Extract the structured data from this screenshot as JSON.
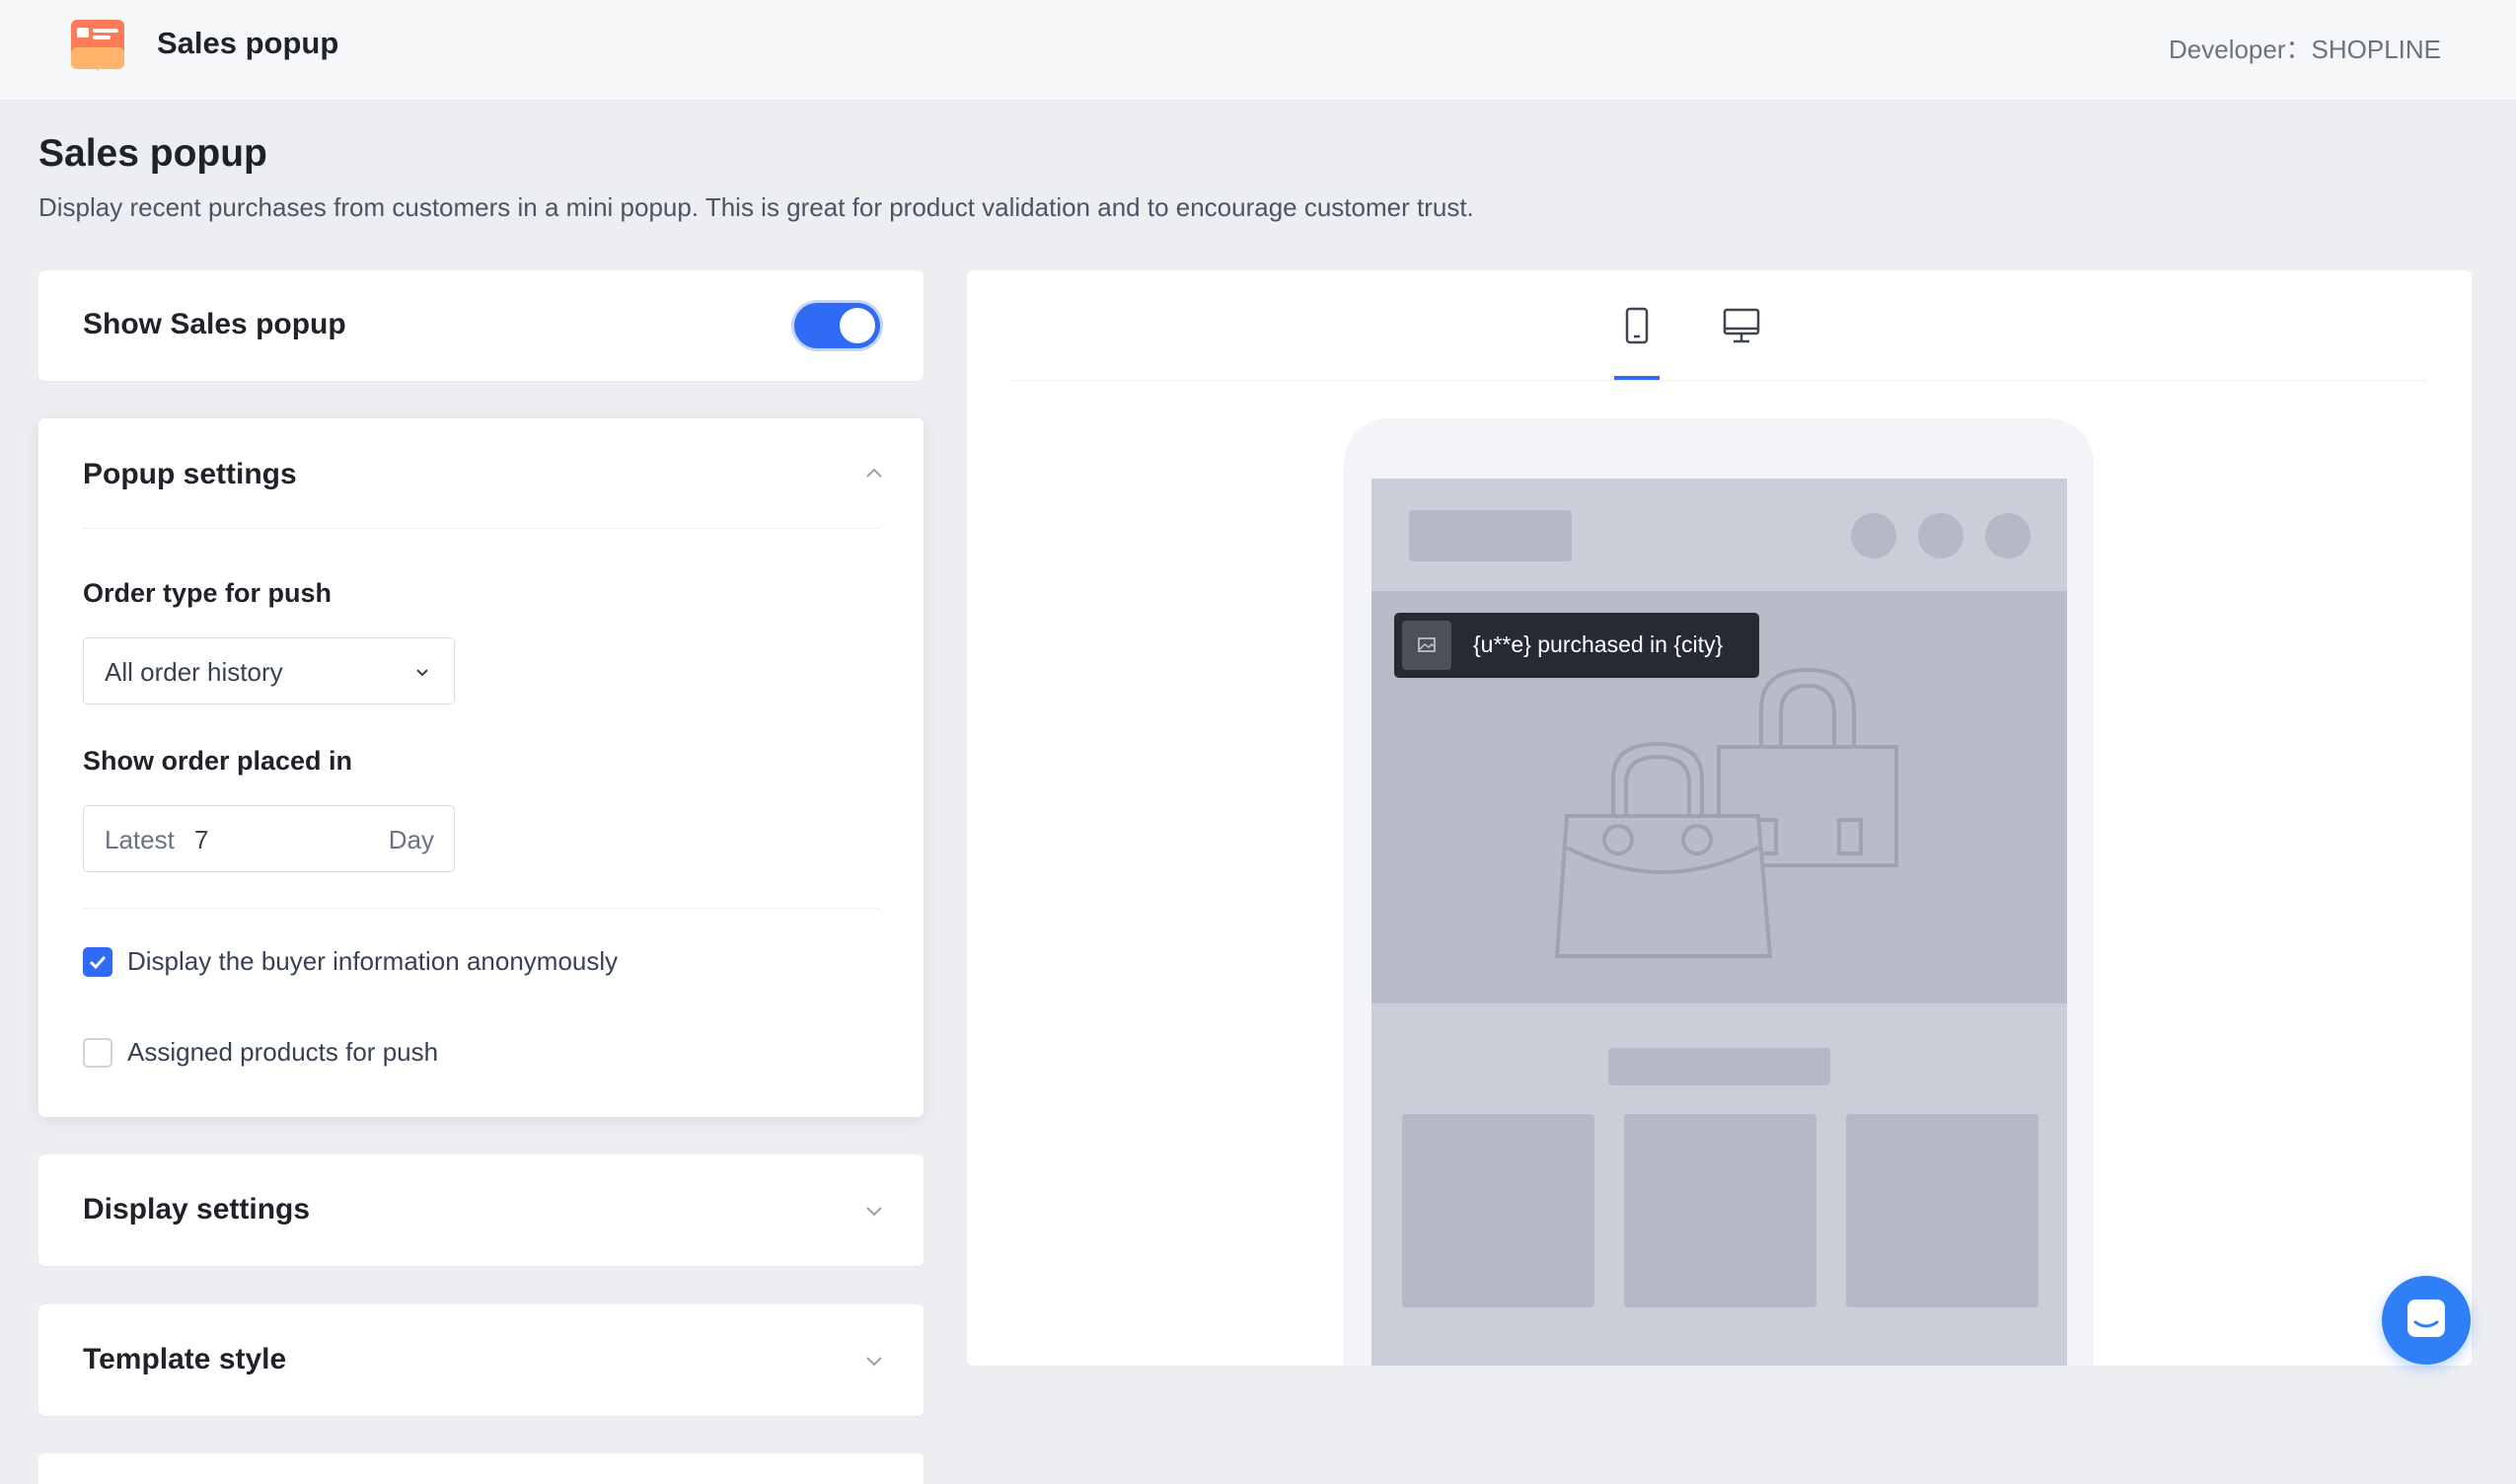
{
  "header": {
    "app_title": "Sales popup",
    "developer": "Developer：SHOPLINE",
    "logo_icon": "sales-popup-app-icon"
  },
  "page": {
    "title": "Sales popup",
    "description": "Display recent purchases from customers in a mini popup. This is great for product validation and to encourage customer trust."
  },
  "show_popup": {
    "label": "Show Sales popup",
    "enabled": true
  },
  "popup_settings": {
    "title": "Popup settings",
    "expanded": true,
    "order_type_label": "Order type for push",
    "order_type_value": "All order history",
    "show_order_label": "Show order placed in",
    "latest_prefix": "Latest",
    "latest_value": "7",
    "latest_suffix": "Day",
    "anonymous_label": "Display the buyer information anonymously",
    "anonymous_checked": true,
    "assigned_label": "Assigned products for push",
    "assigned_checked": false
  },
  "display_settings": {
    "title": "Display settings"
  },
  "template_style": {
    "title": "Template style"
  },
  "preview": {
    "tabs": [
      "mobile-icon",
      "desktop-icon"
    ],
    "active_tab": "mobile-icon",
    "toast_text": "{u**e} purchased in {city}"
  },
  "colors": {
    "accent": "#2f6bf5",
    "chat": "#2f7ff7",
    "toast_bg": "#262a33"
  }
}
